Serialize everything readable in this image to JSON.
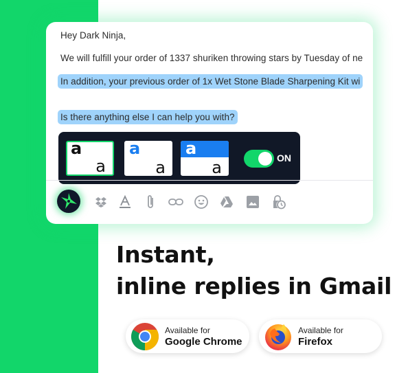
{
  "brand": {
    "accent_green": "#12d66a",
    "highlight_blue": "#9fd3fb",
    "dark_navy": "#111827",
    "style_blue": "#1a7ef0"
  },
  "email": {
    "greeting": "Hey Dark Ninja,",
    "line_order": "We will fulfill your order of 1337 shuriken throwing stars by Tuesday of ne",
    "line_previous": "In addition, your previous order of 1x Wet Stone Blade Sharpening Kit wi",
    "line_help": "Is there anything else I can help you with?"
  },
  "style_picker": {
    "options": [
      {
        "big": "a",
        "small": "a",
        "name": "bold-black",
        "selected": true
      },
      {
        "big": "a",
        "small": "a",
        "name": "blue-text",
        "selected": false
      },
      {
        "big": "a",
        "small": "a",
        "name": "blue-band",
        "selected": false
      }
    ],
    "toggle": {
      "state": true,
      "label": "ON"
    }
  },
  "compose_toolbar": {
    "icons": [
      "ninja-star-icon",
      "dropbox-icon",
      "text-format-icon",
      "attachment-icon",
      "link-icon",
      "emoji-icon",
      "google-drive-icon",
      "photo-icon",
      "schedule-send-icon"
    ]
  },
  "headline": {
    "line1": "Instant,",
    "line2": "inline replies in Gmail"
  },
  "badges": [
    {
      "pre": "Available for",
      "browser": "Google Chrome",
      "icon": "chrome-icon"
    },
    {
      "pre": "Available for",
      "browser": "Firefox",
      "icon": "firefox-icon"
    }
  ]
}
